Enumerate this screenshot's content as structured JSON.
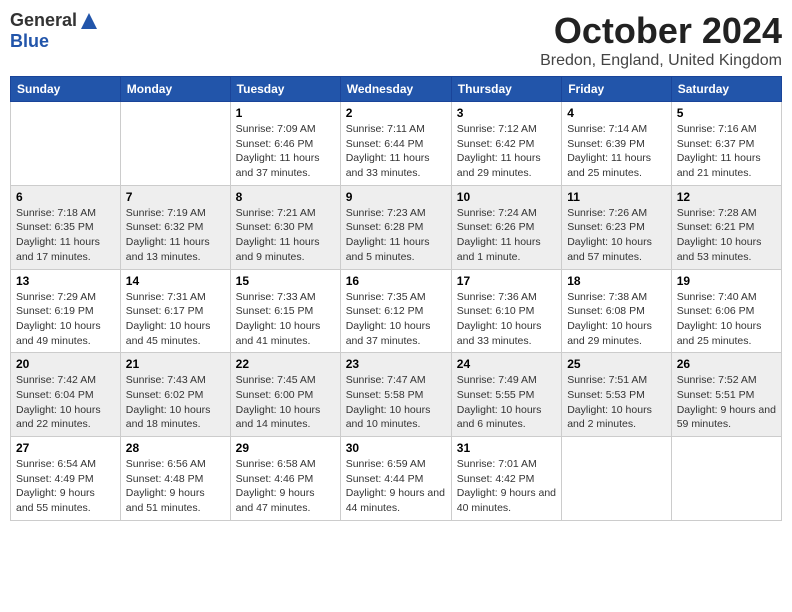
{
  "logo": {
    "general": "General",
    "blue": "Blue"
  },
  "title": {
    "month": "October 2024",
    "location": "Bredon, England, United Kingdom"
  },
  "days_of_week": [
    "Sunday",
    "Monday",
    "Tuesday",
    "Wednesday",
    "Thursday",
    "Friday",
    "Saturday"
  ],
  "weeks": [
    [
      {
        "day": "",
        "info": ""
      },
      {
        "day": "",
        "info": ""
      },
      {
        "day": "1",
        "info": "Sunrise: 7:09 AM\nSunset: 6:46 PM\nDaylight: 11 hours and 37 minutes."
      },
      {
        "day": "2",
        "info": "Sunrise: 7:11 AM\nSunset: 6:44 PM\nDaylight: 11 hours and 33 minutes."
      },
      {
        "day": "3",
        "info": "Sunrise: 7:12 AM\nSunset: 6:42 PM\nDaylight: 11 hours and 29 minutes."
      },
      {
        "day": "4",
        "info": "Sunrise: 7:14 AM\nSunset: 6:39 PM\nDaylight: 11 hours and 25 minutes."
      },
      {
        "day": "5",
        "info": "Sunrise: 7:16 AM\nSunset: 6:37 PM\nDaylight: 11 hours and 21 minutes."
      }
    ],
    [
      {
        "day": "6",
        "info": "Sunrise: 7:18 AM\nSunset: 6:35 PM\nDaylight: 11 hours and 17 minutes."
      },
      {
        "day": "7",
        "info": "Sunrise: 7:19 AM\nSunset: 6:32 PM\nDaylight: 11 hours and 13 minutes."
      },
      {
        "day": "8",
        "info": "Sunrise: 7:21 AM\nSunset: 6:30 PM\nDaylight: 11 hours and 9 minutes."
      },
      {
        "day": "9",
        "info": "Sunrise: 7:23 AM\nSunset: 6:28 PM\nDaylight: 11 hours and 5 minutes."
      },
      {
        "day": "10",
        "info": "Sunrise: 7:24 AM\nSunset: 6:26 PM\nDaylight: 11 hours and 1 minute."
      },
      {
        "day": "11",
        "info": "Sunrise: 7:26 AM\nSunset: 6:23 PM\nDaylight: 10 hours and 57 minutes."
      },
      {
        "day": "12",
        "info": "Sunrise: 7:28 AM\nSunset: 6:21 PM\nDaylight: 10 hours and 53 minutes."
      }
    ],
    [
      {
        "day": "13",
        "info": "Sunrise: 7:29 AM\nSunset: 6:19 PM\nDaylight: 10 hours and 49 minutes."
      },
      {
        "day": "14",
        "info": "Sunrise: 7:31 AM\nSunset: 6:17 PM\nDaylight: 10 hours and 45 minutes."
      },
      {
        "day": "15",
        "info": "Sunrise: 7:33 AM\nSunset: 6:15 PM\nDaylight: 10 hours and 41 minutes."
      },
      {
        "day": "16",
        "info": "Sunrise: 7:35 AM\nSunset: 6:12 PM\nDaylight: 10 hours and 37 minutes."
      },
      {
        "day": "17",
        "info": "Sunrise: 7:36 AM\nSunset: 6:10 PM\nDaylight: 10 hours and 33 minutes."
      },
      {
        "day": "18",
        "info": "Sunrise: 7:38 AM\nSunset: 6:08 PM\nDaylight: 10 hours and 29 minutes."
      },
      {
        "day": "19",
        "info": "Sunrise: 7:40 AM\nSunset: 6:06 PM\nDaylight: 10 hours and 25 minutes."
      }
    ],
    [
      {
        "day": "20",
        "info": "Sunrise: 7:42 AM\nSunset: 6:04 PM\nDaylight: 10 hours and 22 minutes."
      },
      {
        "day": "21",
        "info": "Sunrise: 7:43 AM\nSunset: 6:02 PM\nDaylight: 10 hours and 18 minutes."
      },
      {
        "day": "22",
        "info": "Sunrise: 7:45 AM\nSunset: 6:00 PM\nDaylight: 10 hours and 14 minutes."
      },
      {
        "day": "23",
        "info": "Sunrise: 7:47 AM\nSunset: 5:58 PM\nDaylight: 10 hours and 10 minutes."
      },
      {
        "day": "24",
        "info": "Sunrise: 7:49 AM\nSunset: 5:55 PM\nDaylight: 10 hours and 6 minutes."
      },
      {
        "day": "25",
        "info": "Sunrise: 7:51 AM\nSunset: 5:53 PM\nDaylight: 10 hours and 2 minutes."
      },
      {
        "day": "26",
        "info": "Sunrise: 7:52 AM\nSunset: 5:51 PM\nDaylight: 9 hours and 59 minutes."
      }
    ],
    [
      {
        "day": "27",
        "info": "Sunrise: 6:54 AM\nSunset: 4:49 PM\nDaylight: 9 hours and 55 minutes."
      },
      {
        "day": "28",
        "info": "Sunrise: 6:56 AM\nSunset: 4:48 PM\nDaylight: 9 hours and 51 minutes."
      },
      {
        "day": "29",
        "info": "Sunrise: 6:58 AM\nSunset: 4:46 PM\nDaylight: 9 hours and 47 minutes."
      },
      {
        "day": "30",
        "info": "Sunrise: 6:59 AM\nSunset: 4:44 PM\nDaylight: 9 hours and 44 minutes."
      },
      {
        "day": "31",
        "info": "Sunrise: 7:01 AM\nSunset: 4:42 PM\nDaylight: 9 hours and 40 minutes."
      },
      {
        "day": "",
        "info": ""
      },
      {
        "day": "",
        "info": ""
      }
    ]
  ]
}
